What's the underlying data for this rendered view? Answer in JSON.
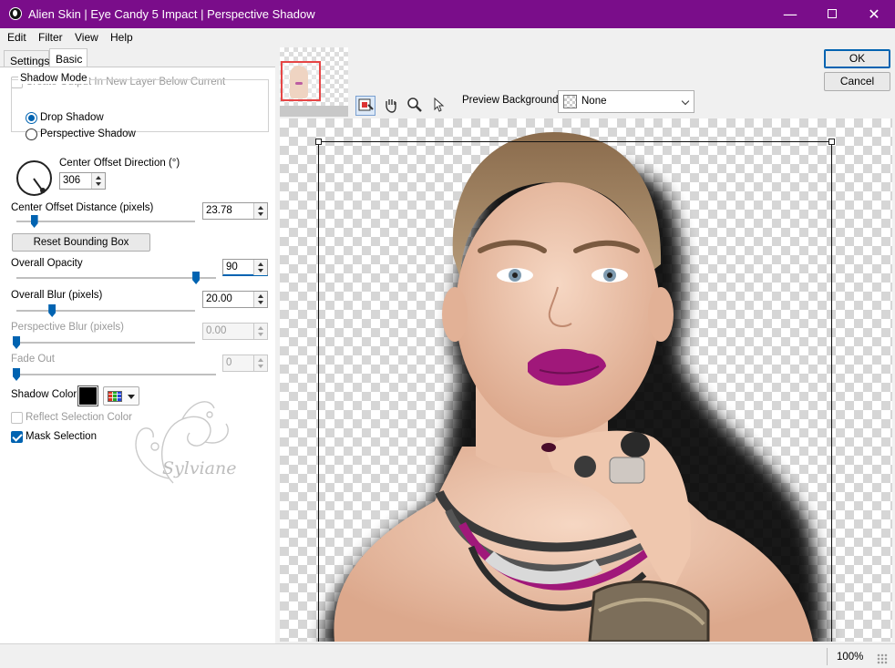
{
  "window": {
    "title": "Alien Skin | Eye Candy 5 Impact | Perspective Shadow",
    "minimize_glyph": "—",
    "close_glyph": "✕"
  },
  "menu": [
    "Edit",
    "Filter",
    "View",
    "Help"
  ],
  "tabs": {
    "settings": "Settings",
    "basic": "Basic",
    "active": "Basic"
  },
  "basic": {
    "create_output_label": "Create Output In New Layer Below Current",
    "create_output_checked": false,
    "shadow_mode_title": "Shadow Mode",
    "shadow_modes": [
      "Drop Shadow",
      "Perspective Shadow"
    ],
    "shadow_mode_selected": "Drop Shadow",
    "center_offset_direction_label": "Center Offset Direction (°)",
    "center_offset_direction_value": "306",
    "center_offset_distance_label": "Center Offset Distance (pixels)",
    "center_offset_distance_value": "23.78",
    "reset_bounding_box_label": "Reset Bounding Box",
    "overall_opacity_label": "Overall Opacity",
    "overall_opacity_value": "90",
    "overall_blur_label": "Overall Blur (pixels)",
    "overall_blur_value": "20.00",
    "perspective_blur_label": "Perspective Blur (pixels)",
    "perspective_blur_value": "0.00",
    "fade_out_label": "Fade Out",
    "fade_out_value": "0",
    "shadow_color_label": "Shadow Color",
    "shadow_color": "#000000",
    "reflect_selection_label": "Reflect Selection Color",
    "reflect_selection_checked": false,
    "mask_selection_label": "Mask Selection",
    "mask_selection_checked": true
  },
  "slider_fractions": {
    "center_offset_distance": 0.1,
    "overall_opacity": 0.9,
    "overall_blur": 0.2,
    "perspective_blur": 0.0,
    "fade_out": 0.0
  },
  "watermark_text": "Sylviane",
  "toolbar": {
    "preview_background_label": "Preview Background:",
    "preview_background_value": "None",
    "tools": [
      "navigator-icon",
      "hand-icon",
      "zoom-icon",
      "arrow-icon"
    ]
  },
  "buttons": {
    "ok": "OK",
    "cancel": "Cancel"
  },
  "status": {
    "zoom": "100%"
  },
  "colors": {
    "titlebar": "#7a0d8a",
    "accent": "#0063b1",
    "lips": "#a0187a"
  }
}
